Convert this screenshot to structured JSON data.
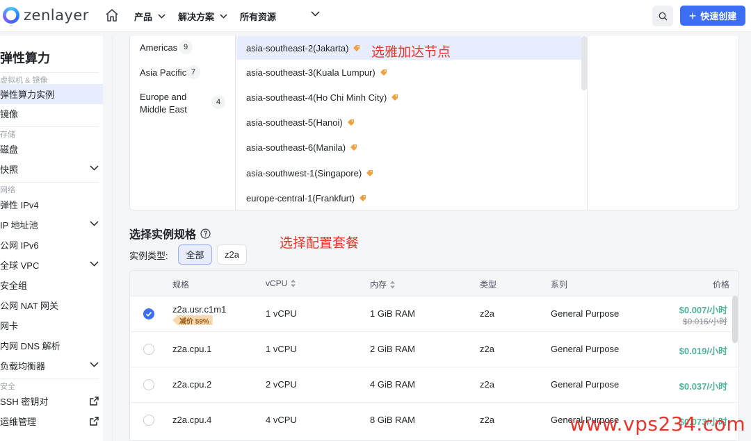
{
  "header": {
    "logo_text": "zenlayer",
    "nav": [
      {
        "label": "产品"
      },
      {
        "label": "解决方案"
      },
      {
        "label": "所有资源"
      }
    ],
    "create_label": "快速创建"
  },
  "sidebar": {
    "title": "弹性算力",
    "groups": {
      "vm": "虚拟机 & 镜像",
      "storage": "存储",
      "network": "网络",
      "security": "安全"
    },
    "items": [
      {
        "label": "弹性算力实例"
      },
      {
        "label": "镜像"
      },
      {
        "label": "磁盘"
      },
      {
        "label": "快照"
      },
      {
        "label": "弹性 IPv4"
      },
      {
        "label": "IP 地址池"
      },
      {
        "label": "公网 IPv6"
      },
      {
        "label": "全球 VPC"
      },
      {
        "label": "安全组"
      },
      {
        "label": "公网 NAT 网关"
      },
      {
        "label": "网卡"
      },
      {
        "label": "内网 DNS 解析"
      },
      {
        "label": "负载均衡器"
      },
      {
        "label": "SSH 密钥对"
      },
      {
        "label": "运维管理"
      }
    ]
  },
  "regions": {
    "categories": [
      {
        "name": "Americas",
        "count": "9"
      },
      {
        "name": "Asia Pacific",
        "count": "7"
      },
      {
        "name": "Europe and Middle East",
        "count": "4"
      }
    ],
    "zones": [
      {
        "name": "asia-southeast-2(Jakarta)",
        "selected": true
      },
      {
        "name": "asia-southeast-3(Kuala Lumpur)"
      },
      {
        "name": "asia-southeast-4(Ho Chi Minh City)"
      },
      {
        "name": "asia-southeast-5(Hanoi)"
      },
      {
        "name": "asia-southeast-6(Manila)"
      },
      {
        "name": "asia-southwest-1(Singapore)"
      },
      {
        "name": "europe-central-1(Frankfurt)"
      }
    ],
    "annotation": "选雅加达节点"
  },
  "instance": {
    "title": "选择实例规格",
    "annotation": "选择配置套餐",
    "type_label": "实例类型:",
    "type_buttons": [
      "全部",
      "z2a"
    ],
    "columns": [
      "规格",
      "vCPU",
      "内存",
      "类型",
      "系列",
      "价格"
    ],
    "rows": [
      {
        "spec": "z2a.usr.c1m1",
        "vcpu": "1 vCPU",
        "memory": "1 GiB RAM",
        "type": "z2a",
        "series": "General Purpose",
        "price": "$0.007/小时",
        "old_price": "$0.016/小时",
        "discount": "减价 59%",
        "checked": true
      },
      {
        "spec": "z2a.cpu.1",
        "vcpu": "1 vCPU",
        "memory": "2 GiB RAM",
        "type": "z2a",
        "series": "General Purpose",
        "price": "$0.019/小时"
      },
      {
        "spec": "z2a.cpu.2",
        "vcpu": "2 vCPU",
        "memory": "4 GiB RAM",
        "type": "z2a",
        "series": "General Purpose",
        "price": "$0.037/小时"
      },
      {
        "spec": "z2a.cpu.4",
        "vcpu": "4 vCPU",
        "memory": "8 GiB RAM",
        "type": "z2a",
        "series": "General Purpose",
        "price": "$0.073/小时"
      }
    ]
  },
  "watermark": "www.vps234.com",
  "colors": {
    "accent": "#3b6ef5",
    "price": "#4fb39a",
    "annotation": "#e8362c",
    "selected_bg": "#e7edfd"
  }
}
